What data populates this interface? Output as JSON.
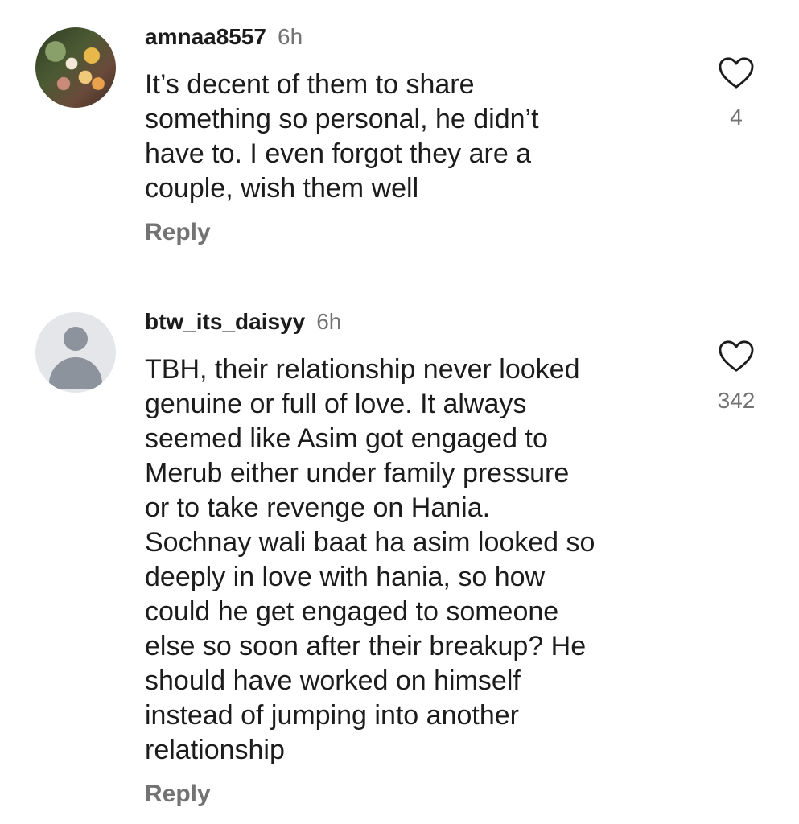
{
  "comments": [
    {
      "username": "amnaa8557",
      "time": "6h",
      "lines": [
        "It’s decent of them to share",
        "something so personal, he didn’t",
        "have to. I even forgot they are a",
        "couple, wish them well"
      ],
      "reply_label": "Reply",
      "likes": "4",
      "avatar_icon": "profile-photo"
    },
    {
      "username": "btw_its_daisyy",
      "time": "6h",
      "lines": [
        "TBH, their relationship never looked",
        "genuine or full of love. It always",
        "seemed like Asim got engaged to",
        "Merub either under family pressure",
        "or to take revenge on Hania.",
        "Sochnay wali baat ha asim looked so",
        "deeply in love with hania, so how",
        "could he get engaged to someone",
        "else so soon after their breakup? He",
        "should have worked on himself",
        "instead of jumping into another",
        "relationship"
      ],
      "reply_label": "Reply",
      "likes": "342",
      "avatar_icon": "default-avatar-icon"
    }
  ],
  "colors": {
    "text": "#1c1c1c",
    "secondary": "#737373",
    "avatar_placeholder": "#8d939c"
  },
  "icons": {
    "like": "heart-outline-icon"
  }
}
